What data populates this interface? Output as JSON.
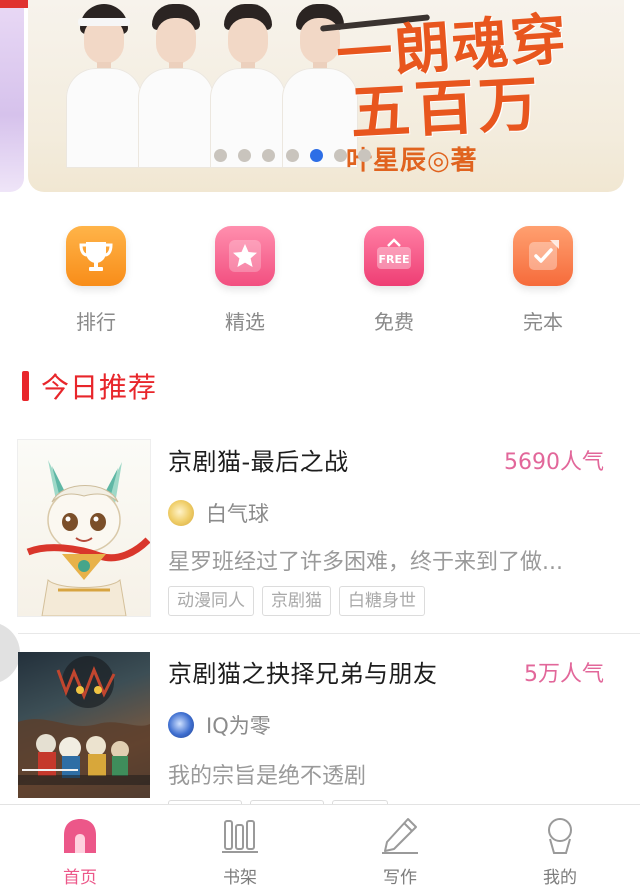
{
  "banner": {
    "title_line1": "一朗魂穿",
    "title_line2": "五百万",
    "author": "叶星辰◎著",
    "dots_count": 7,
    "active_dot": 4
  },
  "quick_nav": [
    {
      "label": "排行",
      "icon": "trophy-icon"
    },
    {
      "label": "精选",
      "icon": "star-icon"
    },
    {
      "label": "免费",
      "icon": "free-tag-icon"
    },
    {
      "label": "完本",
      "icon": "check-note-icon"
    }
  ],
  "section": {
    "title": "今日推荐"
  },
  "books": [
    {
      "title": "京剧猫-最后之战",
      "popularity": "5690人气",
      "author": "白气球",
      "description": "星罗班经过了许多困难，终于来到了做...",
      "tags": [
        "动漫同人",
        "京剧猫",
        "白糖身世"
      ]
    },
    {
      "title": "京剧猫之抉择兄弟与朋友",
      "popularity": "5万人气",
      "author": "IQ为零",
      "description": "我的宗旨是绝不透剧"
    }
  ],
  "tabbar": {
    "items": [
      {
        "label": "首页",
        "icon": "home-icon",
        "active": true
      },
      {
        "label": "书架",
        "icon": "bookshelf-icon",
        "active": false
      },
      {
        "label": "写作",
        "icon": "pen-icon",
        "active": false
      },
      {
        "label": "我的",
        "icon": "profile-icon",
        "active": false
      }
    ],
    "active_color": "#ec5789",
    "inactive_color": "#7c7c7c"
  },
  "colors": {
    "accent_red": "#e8262b",
    "popularity_pink": "#e2679a",
    "carousel_active": "#2d6ee6"
  }
}
